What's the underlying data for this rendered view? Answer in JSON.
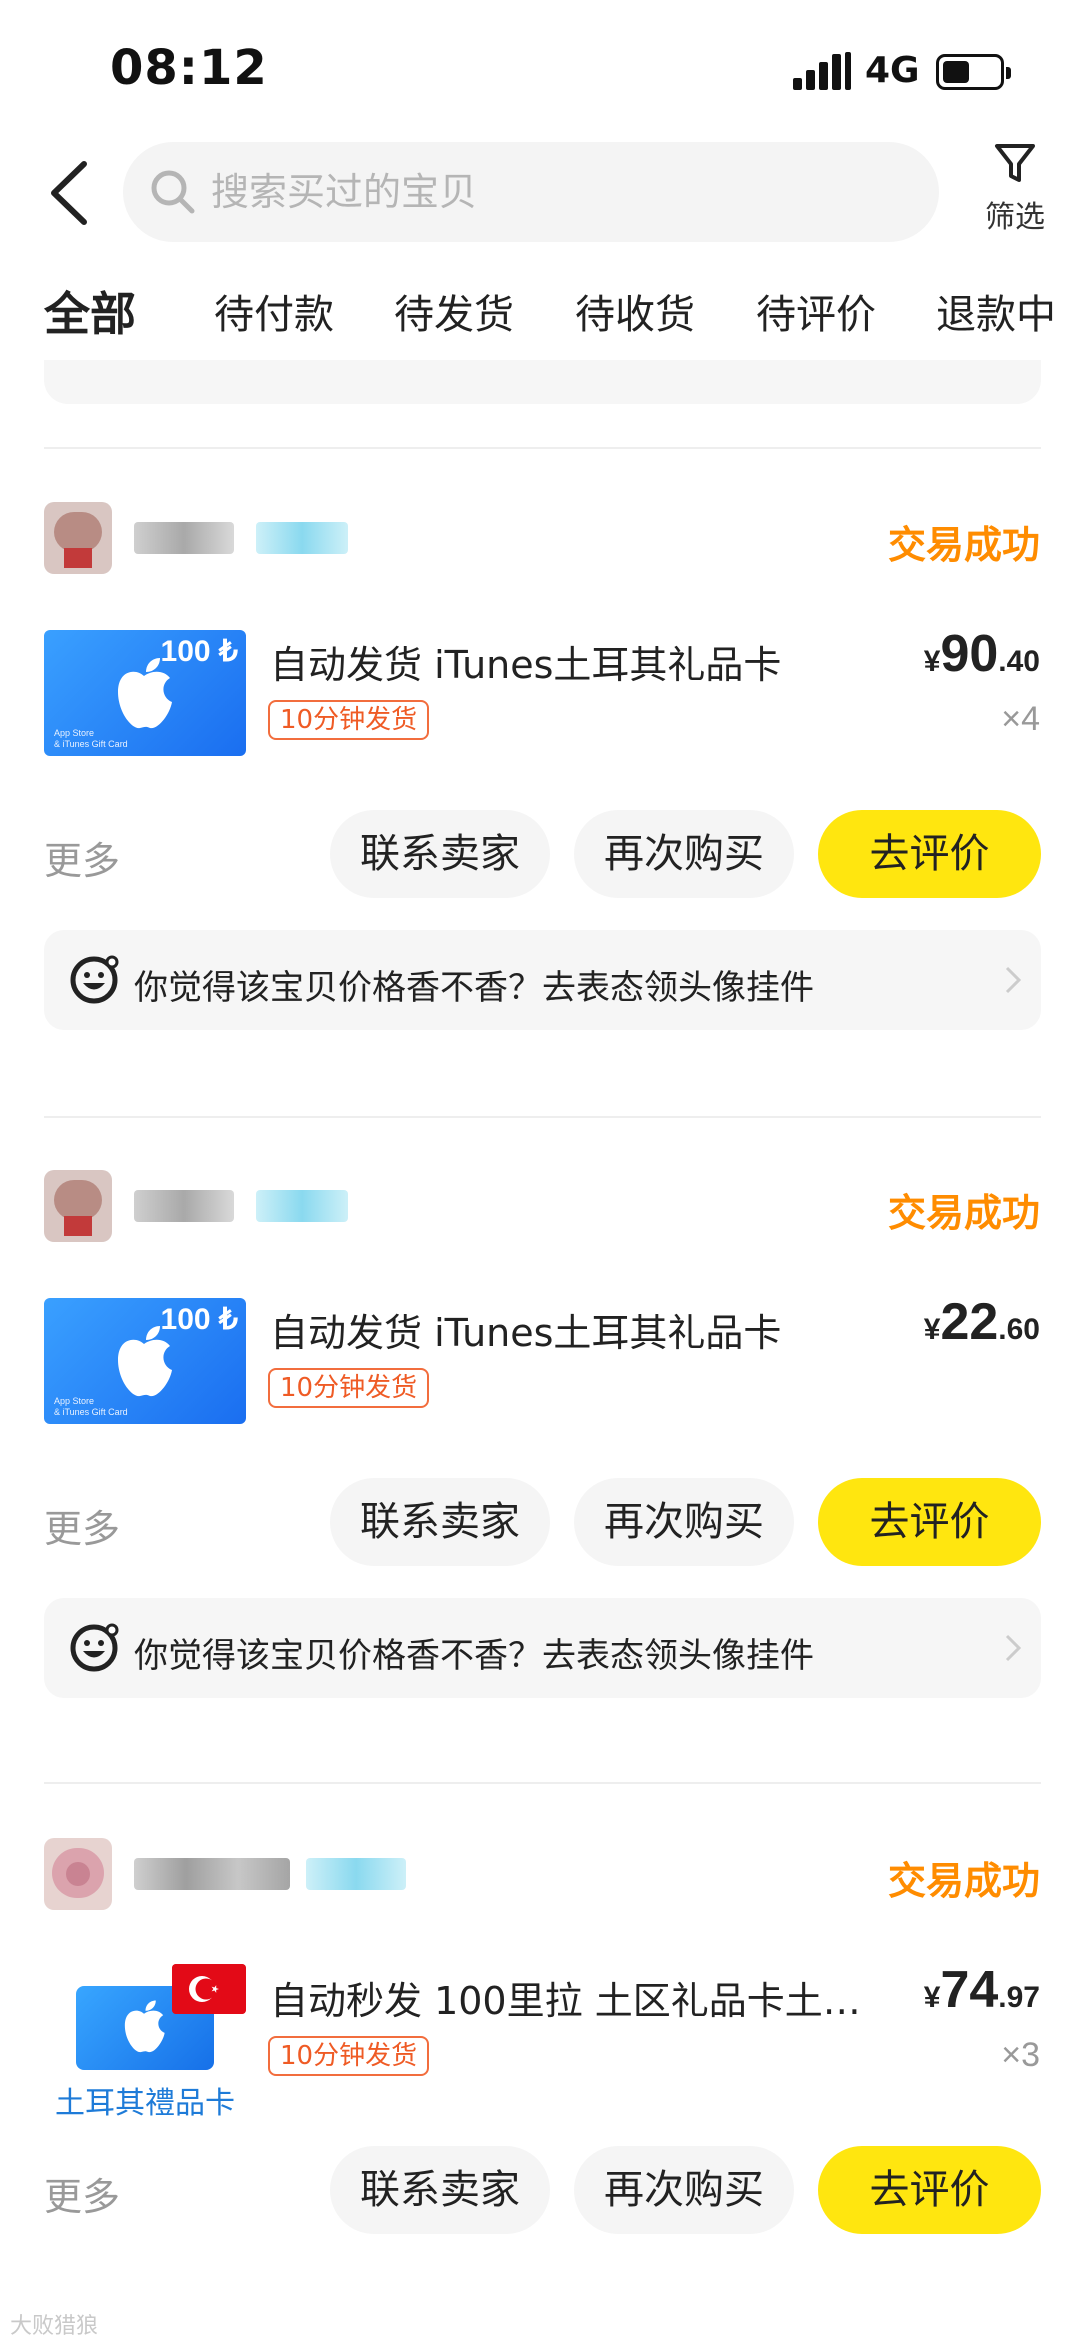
{
  "status_bar": {
    "time": "08:12",
    "network": "4G"
  },
  "search": {
    "placeholder": "搜索买过的宝贝"
  },
  "filter": {
    "label": "筛选"
  },
  "tabs": [
    {
      "label": "全部",
      "active": true
    },
    {
      "label": "待付款"
    },
    {
      "label": "待发货"
    },
    {
      "label": "待收货"
    },
    {
      "label": "待评价"
    },
    {
      "label": "退款中"
    }
  ],
  "orders": [
    {
      "status": "交易成功",
      "item": {
        "title": "自动发货 iTunes土耳其礼品卡",
        "badge": "10分钟发货",
        "card_amount": "100 ₺",
        "card_small": "App Store\n& iTunes Gift Card",
        "price_currency": "¥",
        "price_int": "90",
        "price_dec": ".40",
        "qty": "×4"
      },
      "more": "更多",
      "buttons": {
        "contact": "联系卖家",
        "rebuy": "再次购买",
        "review": "去评价"
      },
      "promo": "你觉得该宝贝价格香不香？去表态领头像挂件"
    },
    {
      "status": "交易成功",
      "item": {
        "title": "自动发货 iTunes土耳其礼品卡",
        "badge": "10分钟发货",
        "card_amount": "100 ₺",
        "card_small": "App Store\n& iTunes Gift Card",
        "price_currency": "¥",
        "price_int": "22",
        "price_dec": ".60",
        "qty": ""
      },
      "more": "更多",
      "buttons": {
        "contact": "联系卖家",
        "rebuy": "再次购买",
        "review": "去评价"
      },
      "promo": "你觉得该宝贝价格香不香？去表态领头像挂件"
    },
    {
      "status": "交易成功",
      "item": {
        "title": "自动秒发 100里拉 土区礼品卡土…",
        "badge": "10分钟发货",
        "card_label": "土耳其禮品卡",
        "price_currency": "¥",
        "price_int": "74",
        "price_dec": ".97",
        "qty": "×3"
      },
      "more": "更多",
      "buttons": {
        "contact": "联系卖家",
        "rebuy": "再次购买",
        "review": "去评价"
      }
    }
  ],
  "colors": {
    "accent_yellow": "#ffe60f",
    "status_orange": "#ff8c00",
    "badge_red": "#ef5b25"
  },
  "watermark": "大败猎狼"
}
